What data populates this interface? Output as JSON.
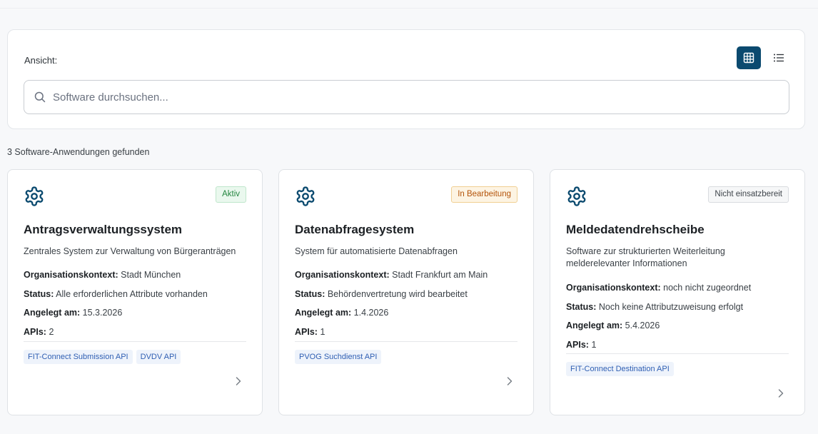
{
  "toolbar": {
    "view_label": "Ansicht:"
  },
  "search": {
    "placeholder": "Software durchsuchen..."
  },
  "results": {
    "count_text": "3 Software-Anwendungen gefunden"
  },
  "labels": {
    "org": "Organisationskontext:",
    "status": "Status:",
    "created": "Angelegt am:",
    "apis": "APIs:"
  },
  "cards": [
    {
      "badge": "Aktiv",
      "title": "Antragsverwaltungssystem",
      "desc": "Zentrales System zur Verwaltung von Bürgeranträgen",
      "org": "Stadt München",
      "status": "Alle erforderlichen Attribute vorhanden",
      "created": "15.3.2026",
      "apis": "2",
      "tags": [
        "FIT-Connect Submission API",
        "DVDV API"
      ]
    },
    {
      "badge": "In Bearbeitung",
      "title": "Datenabfragesystem",
      "desc": "System für automatisierte Datenabfragen",
      "org": "Stadt Frankfurt am Main",
      "status": "Behördenvertretung wird bearbeitet",
      "created": "1.4.2026",
      "apis": "1",
      "tags": [
        "PVOG Suchdienst API"
      ]
    },
    {
      "badge": "Nicht einsatzbereit",
      "title": "Meldedatendrehscheibe",
      "desc": "Software zur strukturierten Weiterleitung melderelevanter Informationen",
      "org": "noch nicht zugeordnet",
      "status": "Noch keine Attributzuweisung erfolgt",
      "created": "5.4.2026",
      "apis": "1",
      "tags": [
        "FIT-Connect Destination API"
      ]
    }
  ],
  "colors": {
    "accent": "#0b4a6f",
    "badge_active": "#23863f",
    "badge_in_progress": "#b4540a",
    "badge_not_ready": "#3f454b",
    "tag_text": "#2f5fb3"
  },
  "icons": [
    "grid-view-icon",
    "list-view-icon",
    "search-icon",
    "gear-icon",
    "chevron-right-icon"
  ]
}
